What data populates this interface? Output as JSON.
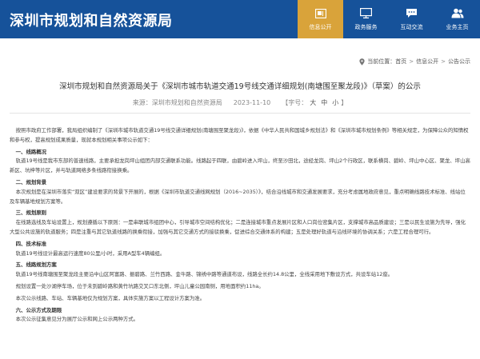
{
  "header": {
    "site_title": "深圳市规划和自然资源局",
    "nav": [
      {
        "label": "信息公开",
        "icon": "folder-doc-icon",
        "active": true
      },
      {
        "label": "政务服务",
        "icon": "monitor-icon",
        "active": false
      },
      {
        "label": "互动交流",
        "icon": "chat-bubble-icon",
        "active": false
      },
      {
        "label": "业务主页",
        "icon": "users-icon",
        "active": false
      }
    ],
    "accent_color": "#d9a33a",
    "bar_color": "#16529a"
  },
  "breadcrumb": {
    "prefix": "当前位置：",
    "items": [
      "首页",
      "信息公开",
      "公告公示"
    ],
    "separator": ">"
  },
  "article": {
    "title": "深圳市规划和自然资源局关于《深圳市城市轨道交通19号线交通详细规划(南塘围至聚龙段)》（草案）的公示",
    "source_label": "来源：",
    "source": "深圳市规划和自然资源局",
    "date": "2023-11-10",
    "font_label": "【字号：",
    "font_sizes": [
      "大",
      "中",
      "小"
    ],
    "font_label_end": "】",
    "intro": "按照市政府工作部署，我局组织编制了《深圳市城市轨道交通19号线交通详细规划(南塘围至聚龙段)》，依据《中华人民共和国城乡规划法》和《深圳市城市规划条例》等相关规定，为保障公众的知情权和参与权，提高规划成果质量，现就本规划相关事项公示如下：",
    "sections": [
      {
        "heading": "一、线路概况",
        "paragraphs": [
          "轨道19号线是我市东部的普速线路，主要承担龙岗坪山组团内部交通联系功能。线路起于四联，由碧岭进入坪山，终至沙田北，途经龙岗、坪山2个行政区，联系横岗、碧岭、坪山中心区、聚龙、坪山高新区、坑梓等片区，并与轨道网络多条线路衔接换乘。"
        ]
      },
      {
        "heading": "二、规划背景",
        "paragraphs": [
          "本次规划是在深圳市落实“双区”建设要求的背景下开展的，根据《深圳市轨道交通线网规划（2016~2035）》，结合沿线城市和交通发展要求，充分考虑属地政府意见，重点明确线路技术标准、线站位及车辆基地规划方案等。"
        ]
      },
      {
        "heading": "三、规划原则",
        "paragraphs": [
          "在线路选线及车站设置上，规划遵循以下原则：一是串联城市组团中心，引导城市空间结构优化；二是连接城市重点发展片区和人口岗位密集片区，支撑城市高品质建设；三是以民生设施为先导，强化大型公共设施的轨道服务；四是注重与其它轨道线路的换乘衔接，加强与其它交通方式的接驳换乘，促进综合交通体系的构建；五是处理好轨道与沿线环境的协调关系；六是工程合理可行。"
        ]
      },
      {
        "heading": "四、技术标准",
        "paragraphs": [
          "轨道19号线设计最高运行速度80公里/小时，采用A型车4辆编组。"
        ]
      },
      {
        "heading": "五、线路规划方案",
        "paragraphs": [
          "轨道19号线南塘围至聚龙段主要沿中山区阿富路、振碧路、兰竹西路、金牛路、锦绣中路等通道布设，线路全长约14.8公里，全线采用地下敷设方式，共设车站12座。",
          "规划设置一处沙湖停车场，位于未到碧岭路和黄竹坑路交叉口东北侧，坪山儿童公园南侧，用地面积约11ha。",
          "本次公示线路、车站、车辆基地仅为规划方案，具体实施方案以工程设计方案为准。"
        ]
      },
      {
        "heading": "六、公示方式及期限",
        "paragraphs": [
          "本次公示征集意见分为展厅公示和网上公示两种方式。"
        ]
      }
    ]
  }
}
